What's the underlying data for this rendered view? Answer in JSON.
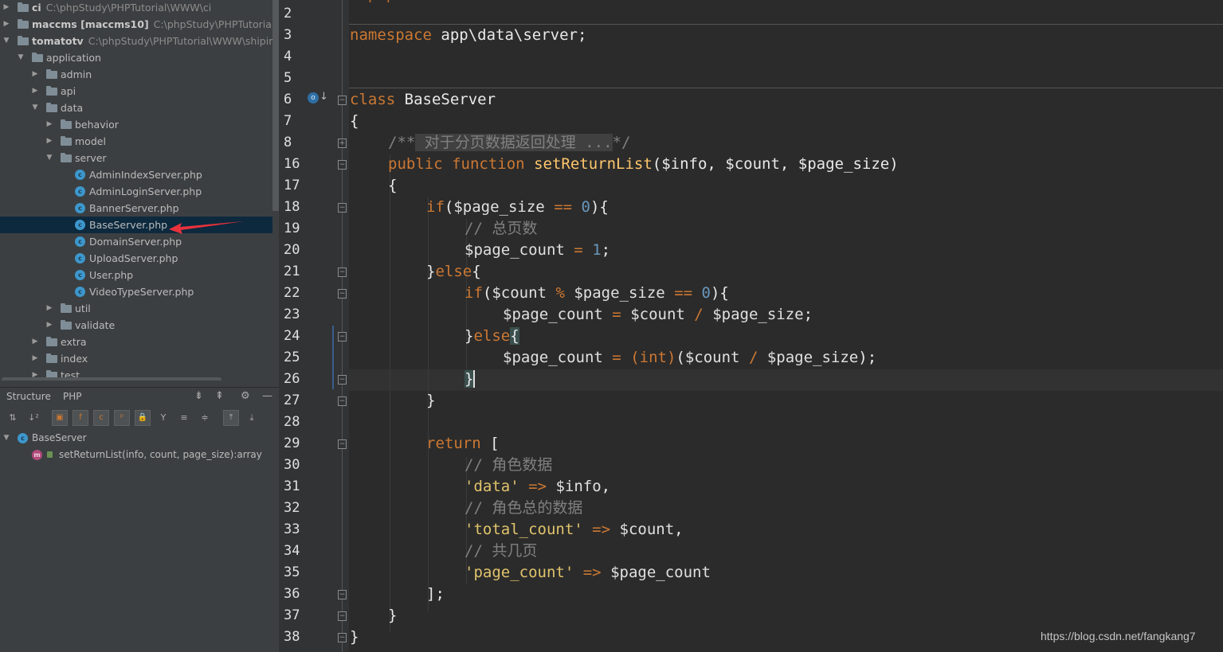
{
  "project_tree": {
    "roots": [
      {
        "name": "ci",
        "path": "C:\\phpStudy\\PHPTutorial\\WWW\\ci"
      },
      {
        "name": "maccms [maccms10]",
        "path": "C:\\phpStudy\\PHPTutorial\\WWW"
      },
      {
        "name": "tomatotv",
        "path": "C:\\phpStudy\\PHPTutorial\\WWW\\shipin\\ton"
      }
    ],
    "folders": {
      "application": "application",
      "admin": "admin",
      "api": "api",
      "data": "data",
      "behavior": "behavior",
      "model": "model",
      "server": "server",
      "util": "util",
      "validate": "validate",
      "extra": "extra",
      "index": "index",
      "test": "test"
    },
    "files": [
      "AdminIndexServer.php",
      "AdminLoginServer.php",
      "BannerServer.php",
      "BaseServer.php",
      "DomainServer.php",
      "UploadServer.php",
      "User.php",
      "VideoTypeServer.php"
    ],
    "selected_file": "BaseServer.php"
  },
  "structure_panel": {
    "tabs": [
      "Structure",
      "PHP"
    ],
    "class_name": "BaseServer",
    "method_signature": "setReturnList(info, count, page_size):array"
  },
  "editor": {
    "line_numbers": [
      "2",
      "3",
      "4",
      "5",
      "6",
      "7",
      "8",
      "16",
      "17",
      "18",
      "19",
      "20",
      "21",
      "22",
      "23",
      "24",
      "25",
      "26",
      "27",
      "28",
      "29",
      "30",
      "31",
      "32",
      "33",
      "34",
      "35",
      "36",
      "37",
      "38"
    ],
    "current_line": "26",
    "code": {
      "ns_kw": "namespace",
      "ns_name": " app\\data\\server;",
      "class_kw": "class",
      "class_name": " BaseServer",
      "open_brace": "{",
      "doc_open": "/**",
      "doc_text": " 对于分页数据返回处理 ...",
      "doc_close": "*/",
      "public_kw": "public",
      "function_kw": "function",
      "method_name": "setReturnList",
      "params": "($info, $count, $page_size)",
      "if_kw": "if",
      "else_kw": "else",
      "cm_total_pages": "// 总页数",
      "var_page_size": "$page_size",
      "var_page_count": "$page_count",
      "var_count": "$count",
      "var_info": "$info",
      "int_cast": "(int)",
      "return_kw": "return",
      "cm_role_data": "// 角色数据",
      "cm_role_total": "// 角色总的数据",
      "cm_pages": "// 共几页",
      "key_data": "'data'",
      "key_total_count": "'total_count'",
      "key_page_count": "'page_count'"
    }
  },
  "watermark": "https://blog.csdn.net/fangkang7"
}
